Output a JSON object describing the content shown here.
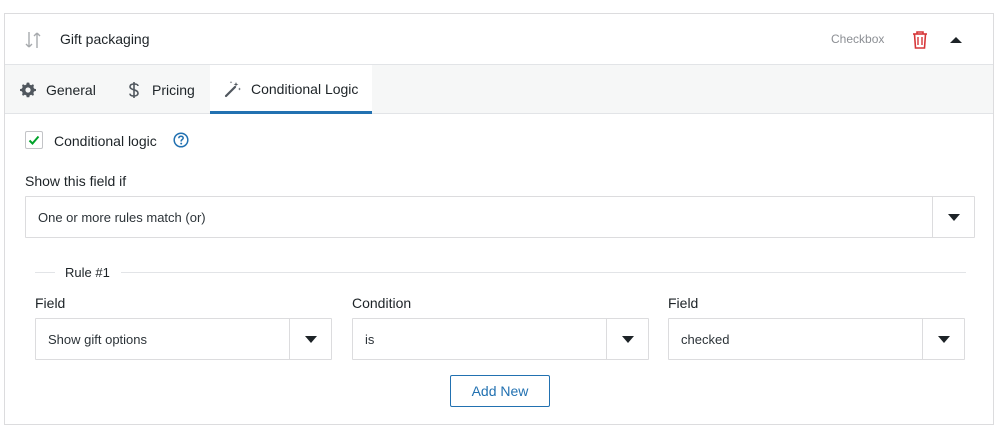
{
  "header": {
    "title": "Gift packaging",
    "field_type": "Checkbox"
  },
  "tabs": [
    {
      "label": "General",
      "icon": "gear-icon"
    },
    {
      "label": "Pricing",
      "icon": "dollar-icon"
    },
    {
      "label": "Conditional Logic",
      "icon": "magic-wand-icon",
      "active": true
    }
  ],
  "conditional": {
    "checkbox_label": "Conditional logic",
    "checked": true,
    "show_label": "Show this field if",
    "match_select": "One or more rules match (or)"
  },
  "rule": {
    "title": "Rule #1",
    "columns": [
      {
        "label": "Field",
        "value": "Show gift options"
      },
      {
        "label": "Condition",
        "value": "is"
      },
      {
        "label": "Field",
        "value": "checked"
      }
    ]
  },
  "actions": {
    "add_new": "Add New"
  },
  "colors": {
    "accent": "#2271b1",
    "danger": "#d63638",
    "check": "#00a32a"
  }
}
